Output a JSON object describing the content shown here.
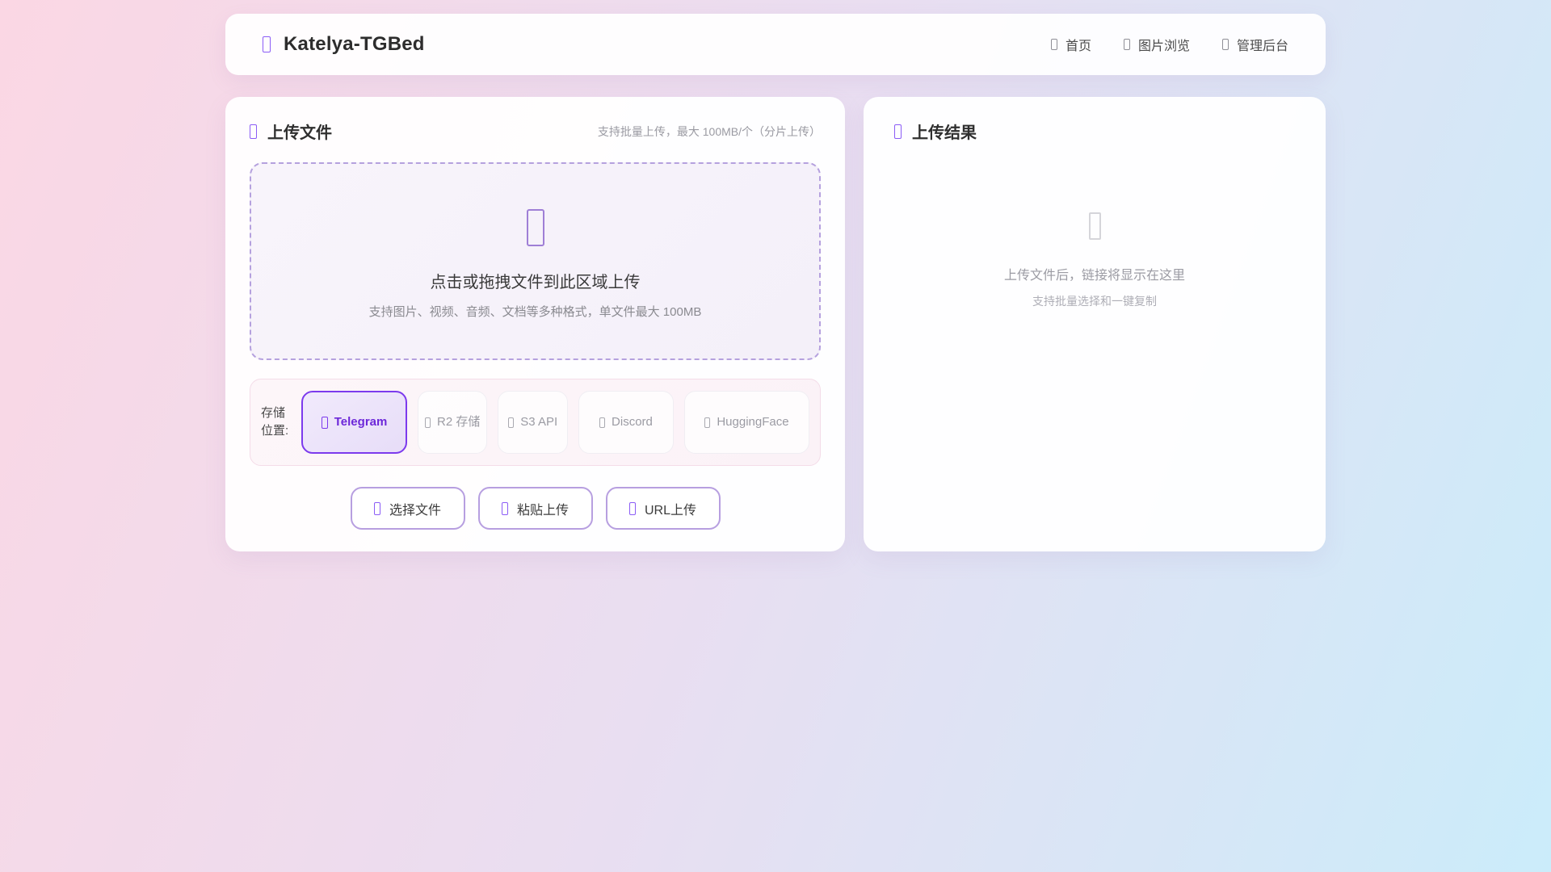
{
  "header": {
    "title": "Katelya-TGBed",
    "nav": [
      {
        "icon": "home-icon",
        "label": "首页"
      },
      {
        "icon": "gallery-icon",
        "label": "图片浏览"
      },
      {
        "icon": "admin-icon",
        "label": "管理后台"
      }
    ]
  },
  "upload_card": {
    "title": "上传文件",
    "subtitle": "支持批量上传，最大 100MB/个（分片上传）",
    "dropzone": {
      "main_text": "点击或拖拽文件到此区域上传",
      "sub_text": "支持图片、视频、音频、文档等多种格式，单文件最大 100MB"
    },
    "storage": {
      "label": "存储位置:",
      "options": [
        {
          "label": "Telegram",
          "selected": true
        },
        {
          "label": "R2 存储",
          "selected": false
        },
        {
          "label": "S3 API",
          "selected": false
        },
        {
          "label": "Discord",
          "selected": false
        },
        {
          "label": "HuggingFace",
          "selected": false
        }
      ]
    },
    "actions": [
      {
        "label": "选择文件"
      },
      {
        "label": "粘贴上传"
      },
      {
        "label": "URL上传"
      }
    ]
  },
  "result_card": {
    "title": "上传结果",
    "empty_state": {
      "line1": "上传文件后，链接将显示在这里",
      "line2": "支持批量选择和一键复制"
    }
  },
  "colors": {
    "accent": "#7c3aed",
    "accent_text": "#6d28d9",
    "bg_gradient_start": "#fbd7e4",
    "bg_gradient_end": "#cbecfa",
    "dropzone_border": "#b5a1de",
    "storage_row_border": "#f4dce8"
  }
}
